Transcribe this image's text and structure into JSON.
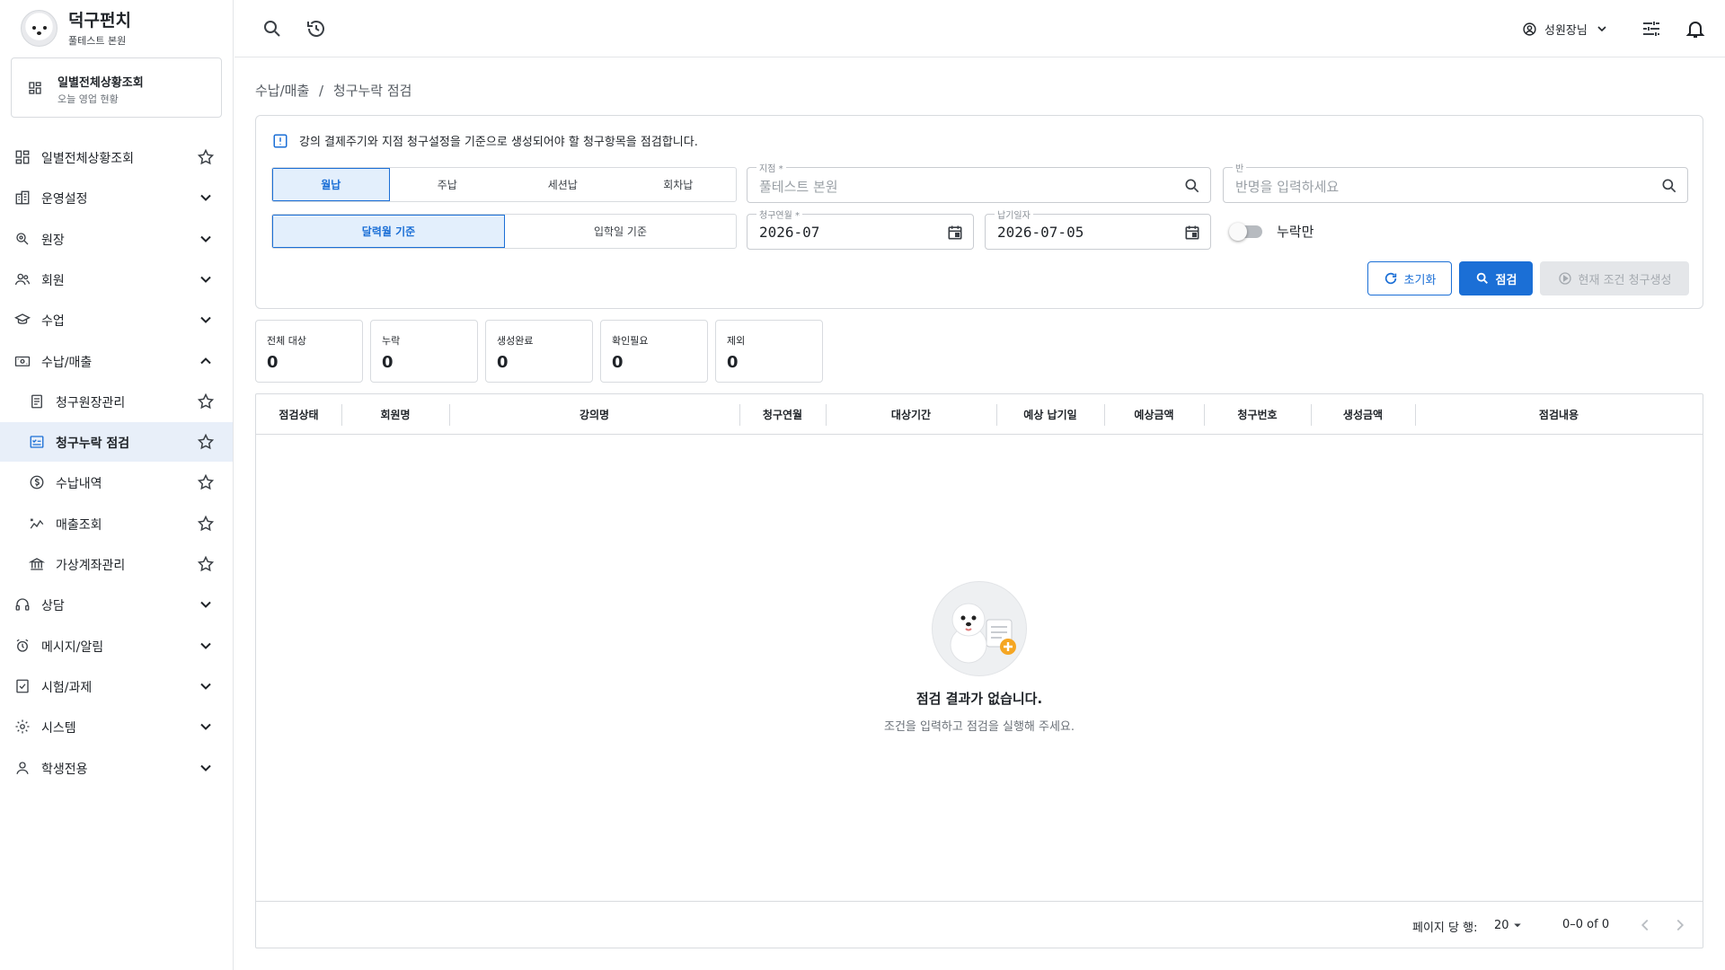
{
  "brand": {
    "name": "덕구펀치",
    "branch": "풀테스트 본원"
  },
  "quick_card": {
    "title": "일별전체상황조회",
    "subtitle": "오늘 영업 현황"
  },
  "nav": [
    {
      "label": "일별전체상황조회",
      "icon": "dashboard-icon",
      "trail": "star"
    },
    {
      "label": "운영설정",
      "icon": "building-icon",
      "trail": "chevron-down"
    },
    {
      "label": "원장",
      "icon": "director-icon",
      "trail": "chevron-down"
    },
    {
      "label": "회원",
      "icon": "members-icon",
      "trail": "chevron-down"
    },
    {
      "label": "수업",
      "icon": "school-icon",
      "trail": "chevron-down"
    },
    {
      "label": "수납/매출",
      "icon": "payment-icon",
      "trail": "chevron-up"
    },
    {
      "label": "청구원장관리",
      "icon": "ledger-icon",
      "trail": "star"
    },
    {
      "label": "청구누락 점검",
      "icon": "checklist-icon",
      "trail": "star"
    },
    {
      "label": "수납내역",
      "icon": "dollar-icon",
      "trail": "star"
    },
    {
      "label": "매출조회",
      "icon": "chart-icon",
      "trail": "star"
    },
    {
      "label": "가상계좌관리",
      "icon": "bank-icon",
      "trail": "star"
    },
    {
      "label": "상담",
      "icon": "headset-icon",
      "trail": "chevron-down"
    },
    {
      "label": "메시지/알림",
      "icon": "alarm-icon",
      "trail": "chevron-down"
    },
    {
      "label": "시험/과제",
      "icon": "exam-icon",
      "trail": "chevron-down"
    },
    {
      "label": "시스템",
      "icon": "settings-icon",
      "trail": "chevron-down"
    },
    {
      "label": "학생전용",
      "icon": "student-icon",
      "trail": "chevron-down"
    }
  ],
  "topbar": {
    "user": "성원장님"
  },
  "breadcrumb": {
    "parent": "수납/매출",
    "sep": "/",
    "current": "청구누락 점검"
  },
  "filters": {
    "notice": "강의 결제주기와 지점 청구설정을 기준으로 생성되어야 할 청구항목을 점검합니다.",
    "cycle_options": [
      "월납",
      "주납",
      "세션납",
      "회차납"
    ],
    "cycle_selected": 0,
    "basis_options": [
      "달력월 기준",
      "입학일 기준"
    ],
    "basis_selected": 0,
    "branch": {
      "label": "지점 *",
      "value": "풀테스트 본원"
    },
    "class": {
      "label": "반",
      "placeholder": "반명을 입력하세요"
    },
    "billing_month": {
      "label": "청구연월 *",
      "value": "2026-07"
    },
    "due_date": {
      "label": "납기일자",
      "value": "2026-07-05"
    },
    "missing_only": {
      "label": "누락만",
      "on": false
    },
    "reset_label": "초기화",
    "check_label": "점검",
    "generate_label": "현재 조건 청구생성"
  },
  "stats": [
    {
      "label": "전체 대상",
      "value": "0"
    },
    {
      "label": "누락",
      "value": "0"
    },
    {
      "label": "생성완료",
      "value": "0"
    },
    {
      "label": "확인필요",
      "value": "0"
    },
    {
      "label": "제외",
      "value": "0"
    }
  ],
  "table": {
    "columns": [
      "점검상태",
      "회원명",
      "강의명",
      "청구연월",
      "대상기간",
      "예상 납기일",
      "예상금액",
      "청구번호",
      "생성금액",
      "점검내용"
    ],
    "empty_title": "점검 결과가 없습니다.",
    "empty_subtitle": "조건을 입력하고 점검을 실행해 주세요.",
    "rows_per_page_label": "페이지 당 행:",
    "rows_per_page": "20",
    "range": "0–0 of 0"
  },
  "colors": {
    "accent": "#1b6fd6",
    "active_bg": "#e8eff9",
    "border": "#d8dbdf"
  }
}
